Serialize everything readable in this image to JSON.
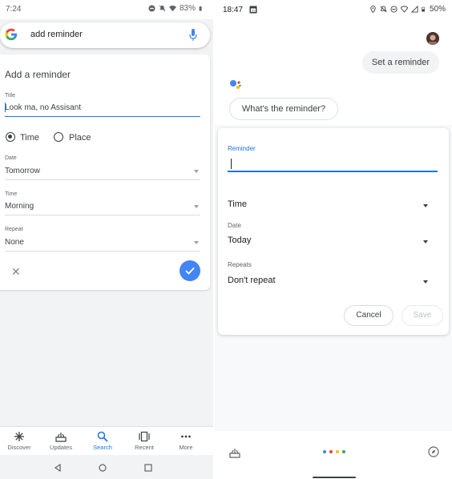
{
  "left": {
    "status": {
      "time": "7:24",
      "battery": "83%"
    },
    "search": {
      "query": "add reminder"
    },
    "form": {
      "heading": "Add a reminder",
      "title_label": "Title",
      "title_value": "Look ma, no Assisant",
      "option_time": "Time",
      "option_place": "Place",
      "date_label": "Date",
      "date_value": "Tomorrow",
      "time_label": "Time",
      "time_value": "Morning",
      "repeat_label": "Repeat",
      "repeat_value": "None"
    },
    "nav": [
      {
        "label": "Discover",
        "icon": "asterisk-icon"
      },
      {
        "label": "Updates",
        "icon": "updates-icon"
      },
      {
        "label": "Search",
        "icon": "search-icon"
      },
      {
        "label": "Recent",
        "icon": "recent-icon"
      },
      {
        "label": "More",
        "icon": "more-icon"
      }
    ]
  },
  "right": {
    "status": {
      "time": "18:47",
      "battery": "50%"
    },
    "user_message": "Set a reminder",
    "assistant_message": "What's the reminder?",
    "form": {
      "reminder_label": "Reminder",
      "time_value": "Time",
      "date_label": "Date",
      "date_value": "Today",
      "repeats_label": "Repeats",
      "repeats_value": "Don't repeat",
      "cancel": "Cancel",
      "save": "Save"
    }
  },
  "colors": {
    "accent": "#1a73e8",
    "fab": "#4285f4"
  }
}
